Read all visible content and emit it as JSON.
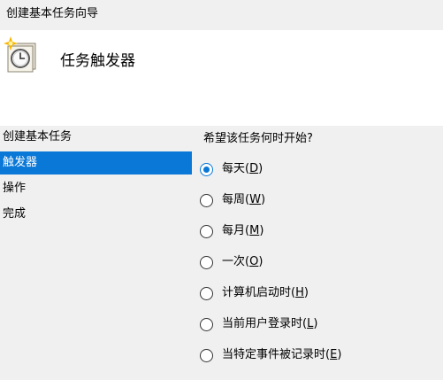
{
  "window": {
    "title": "创建基本任务向导"
  },
  "header": {
    "title": "任务触发器",
    "icon": "scheduled-task-clock-icon"
  },
  "nav": {
    "items": [
      {
        "label": "创建基本任务",
        "selected": false
      },
      {
        "label": "触发器",
        "selected": true
      },
      {
        "label": "操作",
        "selected": false
      },
      {
        "label": "完成",
        "selected": false
      }
    ]
  },
  "main": {
    "question": "希望该任务何时开始?",
    "options": [
      {
        "text": "每天",
        "key": "D",
        "checked": true
      },
      {
        "text": "每周",
        "key": "W",
        "checked": false
      },
      {
        "text": "每月",
        "key": "M",
        "checked": false
      },
      {
        "text": "一次",
        "key": "O",
        "checked": false
      },
      {
        "text": "计算机启动时",
        "key": "H",
        "checked": false
      },
      {
        "text": "当前用户登录时",
        "key": "L",
        "checked": false
      },
      {
        "text": "当特定事件被记录时",
        "key": "E",
        "checked": false
      }
    ]
  },
  "colors": {
    "accent": "#0a78d7",
    "header_bg": "#ffffff",
    "window_bg": "#f0f0f0"
  }
}
